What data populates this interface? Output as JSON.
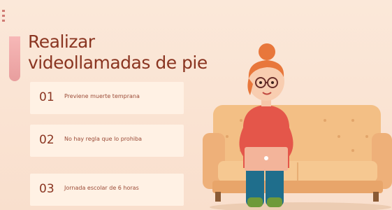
{
  "slide": {
    "title_line1": "Realizar",
    "title_line2": "videollamadas de pie",
    "items": [
      {
        "number": "01",
        "text": "Previene muerte temprana"
      },
      {
        "number": "02",
        "text": "No hay regla que lo prohiba"
      },
      {
        "number": "03",
        "text": "Jornada escolar de 6 horas"
      }
    ]
  },
  "colors": {
    "background": "#fbe6d5",
    "title": "#8a3521",
    "card_background": "#fff1e4",
    "accent_bar": "#f2acab",
    "sofa": "#f1b97e",
    "person_shirt": "#e4564a",
    "person_pants": "#1f6e8c",
    "laptop": "#f3b49a"
  },
  "icons": [
    "menu-dots-icon"
  ]
}
